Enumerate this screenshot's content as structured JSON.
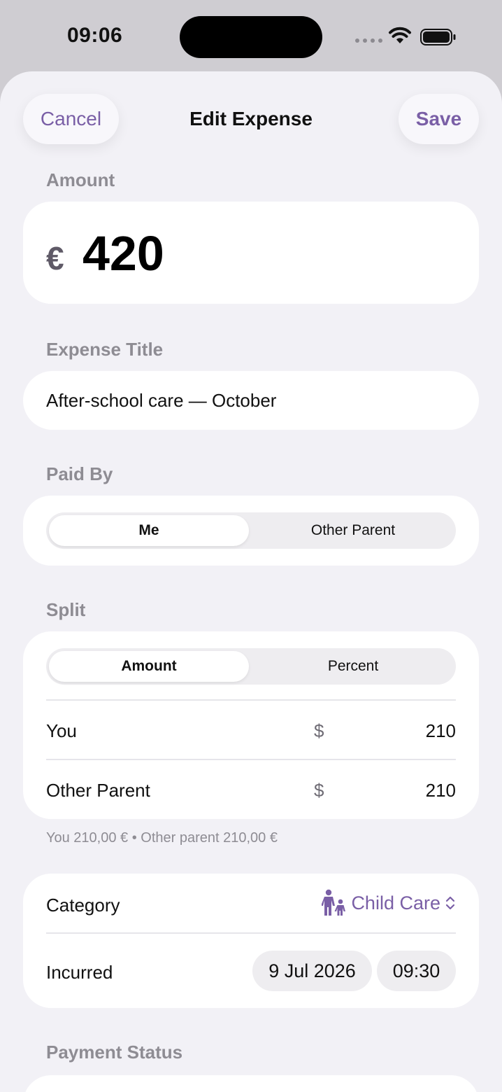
{
  "status_bar": {
    "time": "09:06"
  },
  "nav": {
    "cancel": "Cancel",
    "title": "Edit Expense",
    "save": "Save"
  },
  "amount": {
    "label": "Amount",
    "currency": "€",
    "value": "420"
  },
  "expense_title": {
    "label": "Expense Title",
    "value": "After-school care — October"
  },
  "paid_by": {
    "label": "Paid By",
    "options": [
      "Me",
      "Other Parent"
    ],
    "selected": "Me"
  },
  "split": {
    "label": "Split",
    "modes": [
      "Amount",
      "Percent"
    ],
    "selected_mode": "Amount",
    "rows": [
      {
        "name": "You",
        "currency": "$",
        "value": "210"
      },
      {
        "name": "Other Parent",
        "currency": "$",
        "value": "210"
      }
    ],
    "summary": "You 210,00 € • Other parent 210,00 €"
  },
  "details": {
    "category_label": "Category",
    "category_value": "Child Care",
    "category_icon": "family-icon",
    "incurred_label": "Incurred",
    "date": "9 Jul 2026",
    "time": "09:30"
  },
  "payment_status": {
    "label": "Payment Status"
  },
  "colors": {
    "accent": "#7a5fa6",
    "background": "#f2f1f6",
    "card": "#ffffff"
  }
}
